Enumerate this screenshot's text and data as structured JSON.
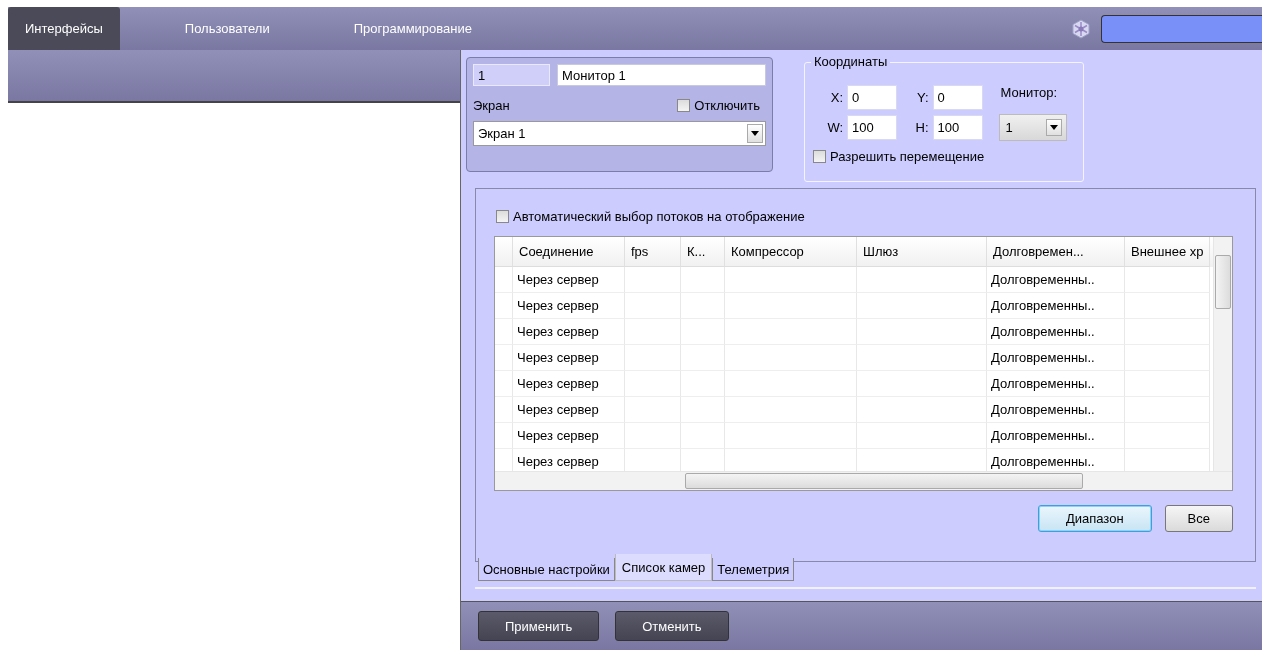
{
  "top_tabs": [
    {
      "label": "Интерфейсы",
      "selected": true
    },
    {
      "label": "Пользователи",
      "selected": false
    },
    {
      "label": "Программирование",
      "selected": false
    }
  ],
  "monitor": {
    "number": "1",
    "name": "Монитор 1",
    "screen_label": "Экран",
    "disable": {
      "label": "Отключить",
      "checked": false
    },
    "screen": "Экран 1"
  },
  "coordinates": {
    "title": "Координаты",
    "fields": [
      {
        "label": "X:",
        "value": "0"
      },
      {
        "label": "Y:",
        "value": "0"
      },
      {
        "label": "W:",
        "value": "100"
      },
      {
        "label": "H:",
        "value": "100"
      }
    ],
    "monitor_label": "Монитор:",
    "monitor": "1",
    "allow_move": {
      "label": "Разрешить перемещение",
      "checked": false
    }
  },
  "camera_list": {
    "auto_select": {
      "label": "Автоматический выбор потоков на отображение",
      "checked": false
    },
    "table": {
      "columns": [
        "Соединение",
        "fps",
        "К...",
        "Компрессор",
        "Шлюз",
        "Долговремен...",
        "Внешнее хр"
      ],
      "rows": [
        [
          "Через сервер",
          null,
          null,
          null,
          null,
          "Долговременны..",
          null
        ],
        [
          "Через сервер",
          null,
          null,
          null,
          null,
          "Долговременны..",
          null
        ],
        [
          "Через сервер",
          null,
          null,
          null,
          null,
          "Долговременны..",
          null
        ],
        [
          "Через сервер",
          null,
          null,
          null,
          null,
          "Долговременны..",
          null
        ],
        [
          "Через сервер",
          null,
          null,
          null,
          null,
          "Долговременны..",
          null
        ],
        [
          "Через сервер",
          null,
          null,
          null,
          null,
          "Долговременны..",
          null
        ],
        [
          "Через сервер",
          null,
          null,
          null,
          null,
          "Долговременны..",
          null
        ],
        [
          "Через сервер",
          null,
          null,
          null,
          null,
          "Долговременны..",
          null
        ]
      ]
    },
    "buttons": [
      {
        "label": "Диапазон",
        "focused": true
      },
      {
        "label": "Все",
        "focused": false
      }
    ]
  },
  "bottom_tabs": [
    {
      "label": "Основные настройки",
      "selected": false
    },
    {
      "label": "Список камер",
      "selected": true
    },
    {
      "label": "Телеметрия",
      "selected": false
    }
  ],
  "actions": [
    "Применить",
    "Отменить"
  ]
}
